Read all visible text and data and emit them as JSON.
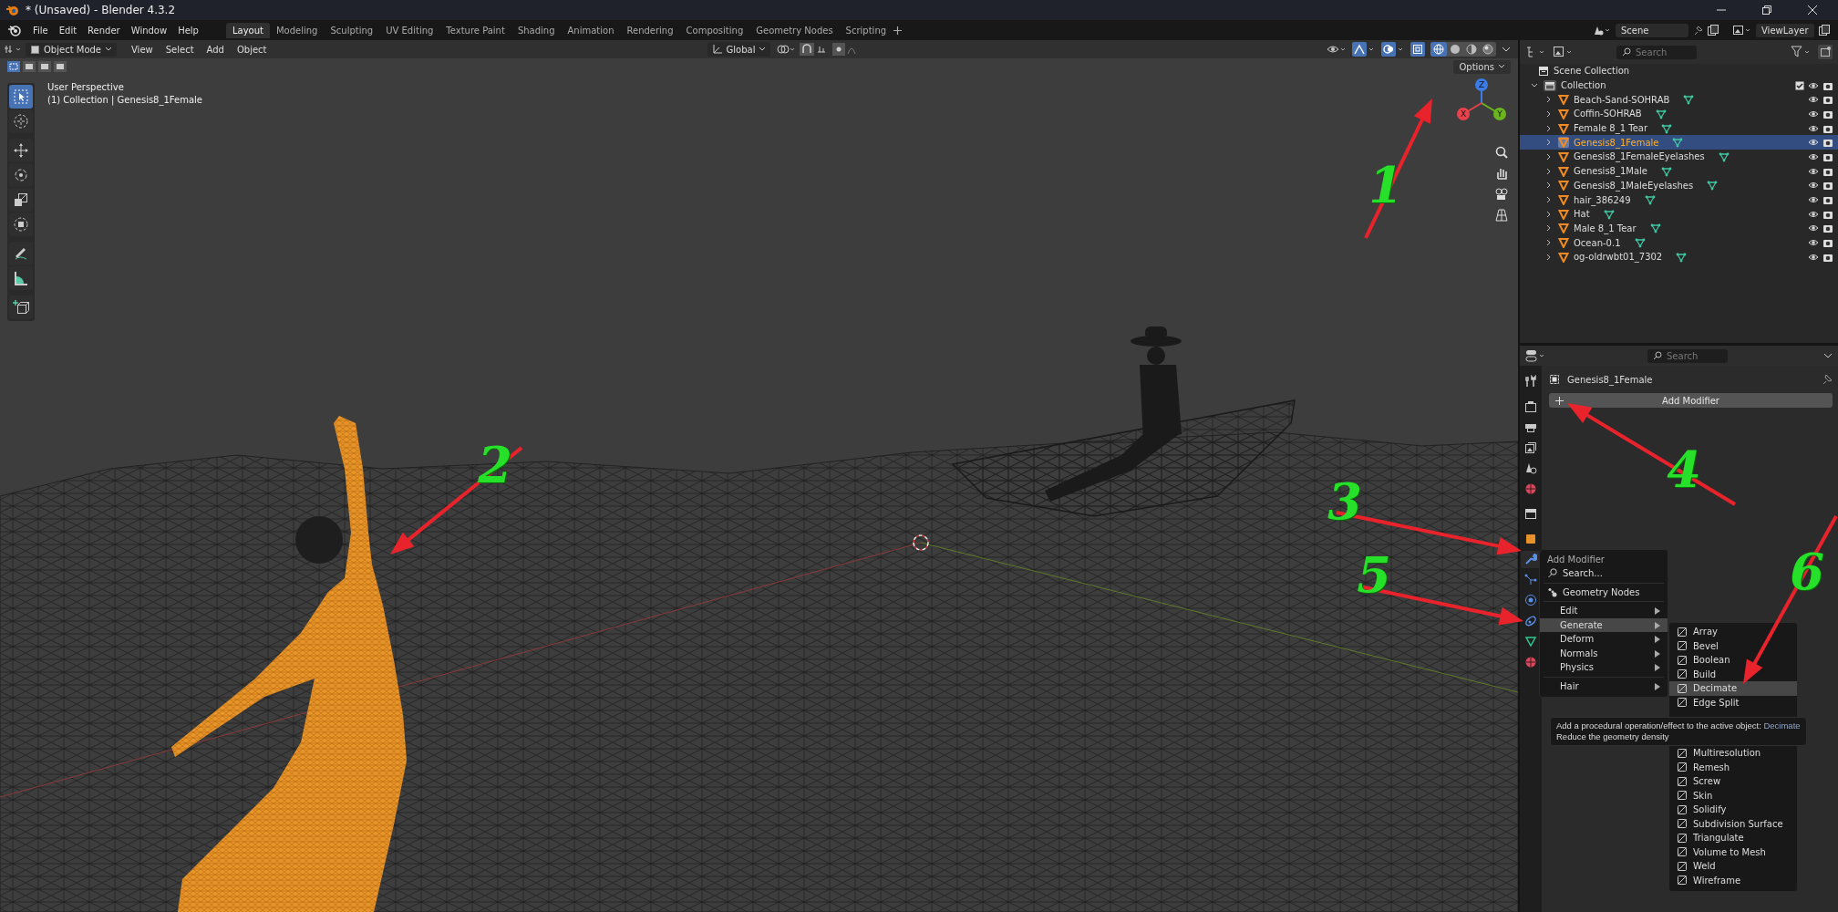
{
  "window": {
    "title": "* (Unsaved) - Blender 4.3.2"
  },
  "menu_bar": [
    "File",
    "Edit",
    "Render",
    "Window",
    "Help"
  ],
  "workspace_tabs": [
    {
      "label": "Layout",
      "selected": true
    },
    {
      "label": "Modeling",
      "selected": false
    },
    {
      "label": "Sculpting",
      "selected": false
    },
    {
      "label": "UV Editing",
      "selected": false
    },
    {
      "label": "Texture Paint",
      "selected": false
    },
    {
      "label": "Shading",
      "selected": false
    },
    {
      "label": "Animation",
      "selected": false
    },
    {
      "label": "Rendering",
      "selected": false
    },
    {
      "label": "Compositing",
      "selected": false
    },
    {
      "label": "Geometry Nodes",
      "selected": false
    },
    {
      "label": "Scripting",
      "selected": false
    }
  ],
  "scene_selector": {
    "scene": "Scene",
    "view_layer": "ViewLayer"
  },
  "viewport_header": {
    "mode": "Object Mode",
    "menus": [
      "View",
      "Select",
      "Add",
      "Object"
    ],
    "orientation": "Global",
    "shading": [
      {
        "kind": "wireframe",
        "selected": true
      },
      {
        "kind": "solid",
        "selected": false
      },
      {
        "kind": "material",
        "selected": false
      },
      {
        "kind": "rendered",
        "selected": false
      }
    ],
    "options": "Options"
  },
  "viewport": {
    "view_name": "User Perspective",
    "context": "(1) Collection | Genesis8_1Female",
    "tools": [
      {
        "kind": "select",
        "selected": true
      },
      {
        "kind": "cursor",
        "selected": false
      },
      {
        "kind": "move",
        "selected": false
      },
      {
        "kind": "rotate",
        "selected": false
      },
      {
        "kind": "scale",
        "selected": false
      },
      {
        "kind": "transform",
        "selected": false
      },
      {
        "kind": "annotate",
        "selected": false
      },
      {
        "kind": "measure",
        "selected": false
      },
      {
        "kind": "add_cube",
        "selected": false
      }
    ],
    "gizmo_axes": [
      {
        "kind": "z",
        "label": "Z"
      },
      {
        "kind": "y",
        "label": "Y"
      },
      {
        "kind": "x",
        "label": "X"
      }
    ]
  },
  "outliner": {
    "search_placeholder": "Search",
    "tree": [
      {
        "label": "Scene Collection",
        "kind": "scene_collection",
        "children": [
          {
            "label": "Collection",
            "kind": "collection",
            "expanded": true,
            "checked": true,
            "selected": false,
            "children": [
              {
                "label": "Beach-Sand-SOHRAB",
                "kind": "mesh",
                "expanded": false,
                "selected": false
              },
              {
                "label": "Coffin-SOHRAB",
                "kind": "mesh",
                "expanded": false,
                "selected": false
              },
              {
                "label": "Female 8_1 Tear",
                "kind": "mesh",
                "expanded": false,
                "selected": false
              },
              {
                "label": "Genesis8_1Female",
                "kind": "mesh",
                "expanded": false,
                "selected": true
              },
              {
                "label": "Genesis8_1FemaleEyelashes",
                "kind": "mesh",
                "expanded": false,
                "selected": false
              },
              {
                "label": "Genesis8_1Male",
                "kind": "mesh",
                "expanded": false,
                "selected": false
              },
              {
                "label": "Genesis8_1MaleEyelashes",
                "kind": "mesh",
                "expanded": false,
                "selected": false
              },
              {
                "label": "hair_386249",
                "kind": "mesh",
                "expanded": false,
                "selected": false
              },
              {
                "label": "Hat",
                "kind": "mesh",
                "expanded": false,
                "selected": false
              },
              {
                "label": "Male 8_1 Tear",
                "kind": "mesh",
                "expanded": false,
                "selected": false
              },
              {
                "label": "Ocean-0.1",
                "kind": "mesh",
                "expanded": false,
                "selected": false
              },
              {
                "label": "og-oldrwbt01_7302",
                "kind": "mesh",
                "expanded": false,
                "selected": false
              }
            ]
          }
        ]
      }
    ]
  },
  "properties": {
    "search_placeholder": "Search",
    "object_name": "Genesis8_1Female",
    "add_modifier": "Add Modifier",
    "tabs": [
      {
        "kind": "tool",
        "selected": false
      },
      {
        "kind": "render",
        "selected": false
      },
      {
        "kind": "output",
        "selected": false
      },
      {
        "kind": "view_layer",
        "selected": false
      },
      {
        "kind": "scene",
        "selected": false
      },
      {
        "kind": "world",
        "selected": false
      },
      {
        "kind": "collection",
        "selected": false
      },
      {
        "kind": "object",
        "selected": false
      },
      {
        "kind": "modifiers",
        "selected": true
      },
      {
        "kind": "particles",
        "selected": false
      },
      {
        "kind": "physics",
        "selected": false
      },
      {
        "kind": "constraints",
        "selected": false
      },
      {
        "kind": "data",
        "selected": false
      },
      {
        "kind": "material",
        "selected": false
      }
    ]
  },
  "add_modifier_menu": {
    "title": "Add Modifier",
    "search": "Search...",
    "geometry_nodes": "Geometry Nodes",
    "sections": [
      {
        "items": [
          {
            "label": "Edit",
            "selected": false
          },
          {
            "label": "Generate",
            "selected": true
          },
          {
            "label": "Deform",
            "selected": false
          },
          {
            "label": "Normals",
            "selected": false
          },
          {
            "label": "Physics",
            "selected": false
          }
        ]
      },
      {
        "items": [
          {
            "label": "Hair",
            "selected": false
          }
        ]
      }
    ]
  },
  "generate_submenu": {
    "sections": [
      {
        "items": [
          {
            "label": "Array",
            "selected": false
          },
          {
            "label": "Bevel",
            "selected": false
          },
          {
            "label": "Boolean",
            "selected": false
          },
          {
            "label": "Build",
            "selected": false
          },
          {
            "label": "Decimate",
            "selected": true
          },
          {
            "label": "Edge Split",
            "selected": false
          }
        ]
      },
      {
        "items": [
          {
            "label": "Multiresolution",
            "selected": false
          },
          {
            "label": "Remesh",
            "selected": false
          },
          {
            "label": "Screw",
            "selected": false
          },
          {
            "label": "Skin",
            "selected": false
          },
          {
            "label": "Solidify",
            "selected": false
          },
          {
            "label": "Subdivision Surface",
            "selected": false
          },
          {
            "label": "Triangulate",
            "selected": false
          },
          {
            "label": "Volume to Mesh",
            "selected": false
          },
          {
            "label": "Weld",
            "selected": false
          },
          {
            "label": "Wireframe",
            "selected": false
          }
        ]
      }
    ]
  },
  "tooltip": {
    "text": "Add a procedural operation/effect to the active object:",
    "highlight": "Decimate",
    "description": "Reduce the geometry density"
  },
  "annotations": [
    {
      "label": "1"
    },
    {
      "label": "2"
    },
    {
      "label": "3"
    },
    {
      "label": "4"
    },
    {
      "label": "5"
    },
    {
      "label": "6"
    }
  ]
}
